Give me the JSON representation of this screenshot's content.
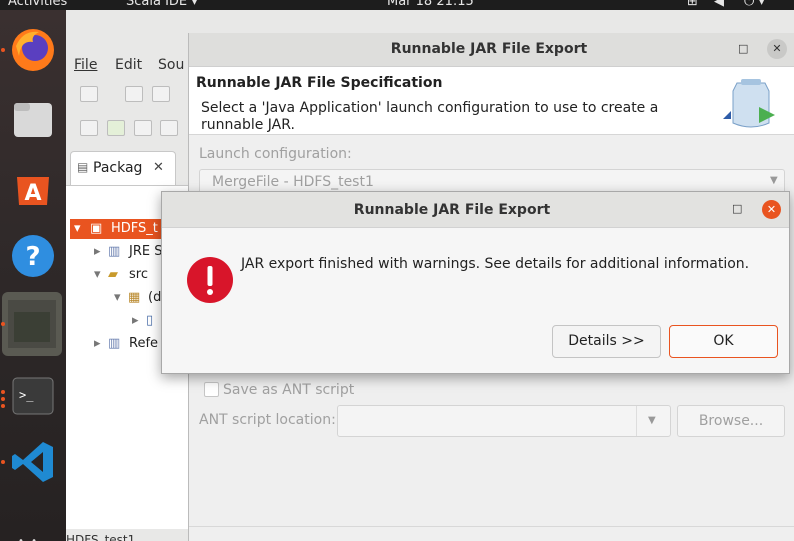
{
  "topbar": {
    "activities": "Activities",
    "app": "Scala IDE",
    "clock": "Mar 18  21:15"
  },
  "eclipse": {
    "menu": [
      "File",
      "Edit",
      "Sou"
    ],
    "package_tab": "Packag",
    "tree": {
      "project": "HDFS_t",
      "jre": "JRE S",
      "src": "src",
      "pkg": "(d",
      "refs": "Refe"
    },
    "status": "HDFS_test1"
  },
  "wizard": {
    "title": "Runnable JAR File Export",
    "heading": "Runnable JAR File Specification",
    "description": "Select a 'Java Application' launch configuration to use to create a runnable JAR.",
    "launch_label": "Launch configuration:",
    "launch_value": "MergeFile - HDFS_test1",
    "ant_checkbox": "Save as ANT script",
    "ant_location_label": "ANT script location:",
    "browse": "Browse..."
  },
  "alert": {
    "title": "Runnable JAR File Export",
    "message": "JAR export finished with warnings. See details for additional information.",
    "details": "Details >>",
    "ok": "OK"
  },
  "colors": {
    "accent": "#e95420",
    "error": "#d8152a"
  }
}
